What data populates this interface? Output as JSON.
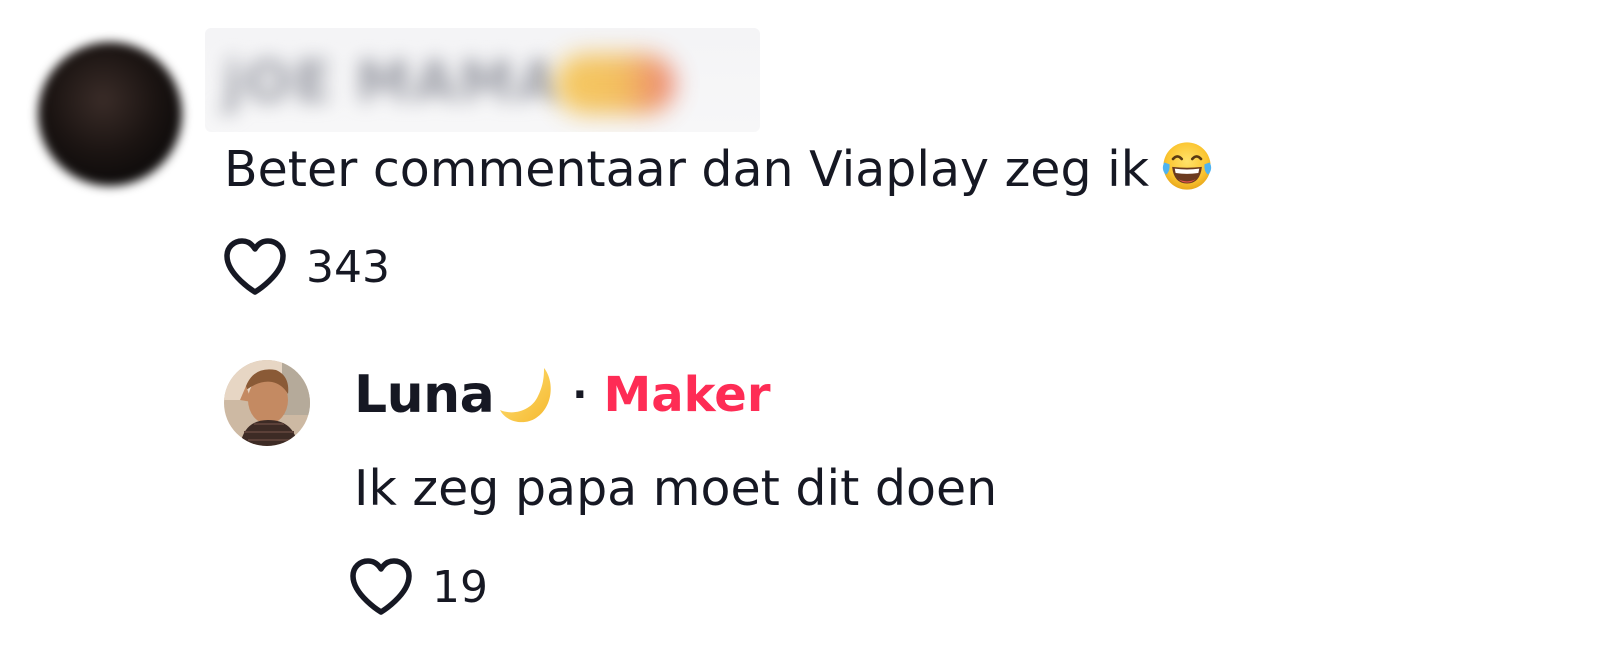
{
  "top_comment": {
    "username": "jOE MAMA",
    "text": "Beter commentaar dan Viaplay zeg ik",
    "emoji": "face-with-tears-of-joy",
    "likes": "343"
  },
  "reply": {
    "username": "Luna",
    "username_emoji": "crescent-moon",
    "separator": "·",
    "badge": "Maker",
    "text": "Ik zeg papa moet dit doen",
    "likes": "19"
  },
  "colors": {
    "text": "#161823",
    "maker_badge": "#fe2c55",
    "background": "#ffffff"
  }
}
